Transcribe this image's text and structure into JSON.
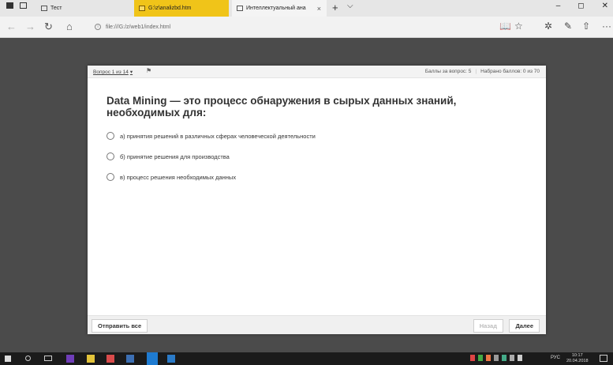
{
  "browser": {
    "tabs": [
      {
        "label": "Тест"
      },
      {
        "label": "G:\\z\\analizbd.htm"
      },
      {
        "label": "Интеллектуальный ана",
        "close": "×"
      }
    ],
    "new_tab": "+",
    "tab_list": "⌵",
    "window_controls": {
      "minimize": "–",
      "maximize": "◻",
      "close": "✕"
    },
    "address": "file:///G:/z/web1/index.html",
    "nav": {
      "back": "←",
      "forward": "→",
      "refresh": "↻",
      "home": "⌂"
    },
    "toolbar": {
      "reading": "📖",
      "favorite": "☆",
      "favorites_hub": "✲",
      "notes": "✎",
      "share": "⇧",
      "more": "···"
    }
  },
  "quiz": {
    "question_nav": "Вопрос 1 из 14",
    "nav_arrow": "▾",
    "flag": "⚑",
    "points_question": "Баллы за вопрос: 5",
    "separator": "|",
    "points_total": "Набрано баллов: 0 из 70",
    "question": "Data Mining — это процесс обнаружения в сырых данных знаний, необходимых для:",
    "answers": [
      {
        "label": "а) принятия решений в различных сферах человеческой деятельности"
      },
      {
        "label": "б) принятие решения для производства"
      },
      {
        "label": "в) процесс решения необходимых данных"
      }
    ],
    "submit_all": "Отправить все",
    "back": "Назад",
    "next": "Далее"
  },
  "taskbar": {
    "language": "РУС",
    "time": "10:17",
    "date": "20.04.2018"
  }
}
